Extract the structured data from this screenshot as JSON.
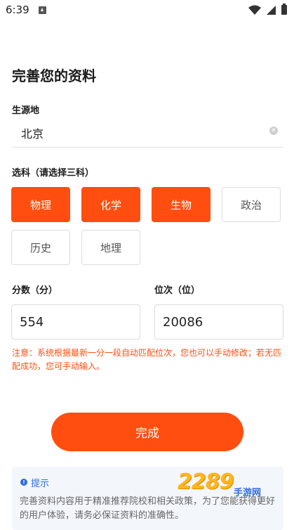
{
  "status": {
    "time": "6:39"
  },
  "page": {
    "title": "完善您的资料"
  },
  "origin": {
    "label": "生源地",
    "value": "北京"
  },
  "subjects": {
    "label": "选科（请选择三科）",
    "items": [
      {
        "label": "物理",
        "selected": true
      },
      {
        "label": "化学",
        "selected": true
      },
      {
        "label": "生物",
        "selected": true
      },
      {
        "label": "政治",
        "selected": false
      },
      {
        "label": "历史",
        "selected": false
      },
      {
        "label": "地理",
        "selected": false
      }
    ]
  },
  "score": {
    "label": "分数（分）",
    "value": "554"
  },
  "rank": {
    "label": "位次（位）",
    "value": "20086"
  },
  "note": "注意：系统根据最新一分一段自动匹配位次，您也可以手动修改；若无匹配成功，您可手动输入。",
  "done_button": "完成",
  "tip": {
    "title": "提示",
    "text": "完善资料内容用于精准推荐院校和相关政策，为了您能获得更好的用户体验，请务必保证资料的准确性。"
  },
  "watermark": {
    "logo": "2289",
    "site": "手游网"
  },
  "colors": {
    "accent": "#ff4e0f",
    "tip_blue": "#2f6be0"
  }
}
